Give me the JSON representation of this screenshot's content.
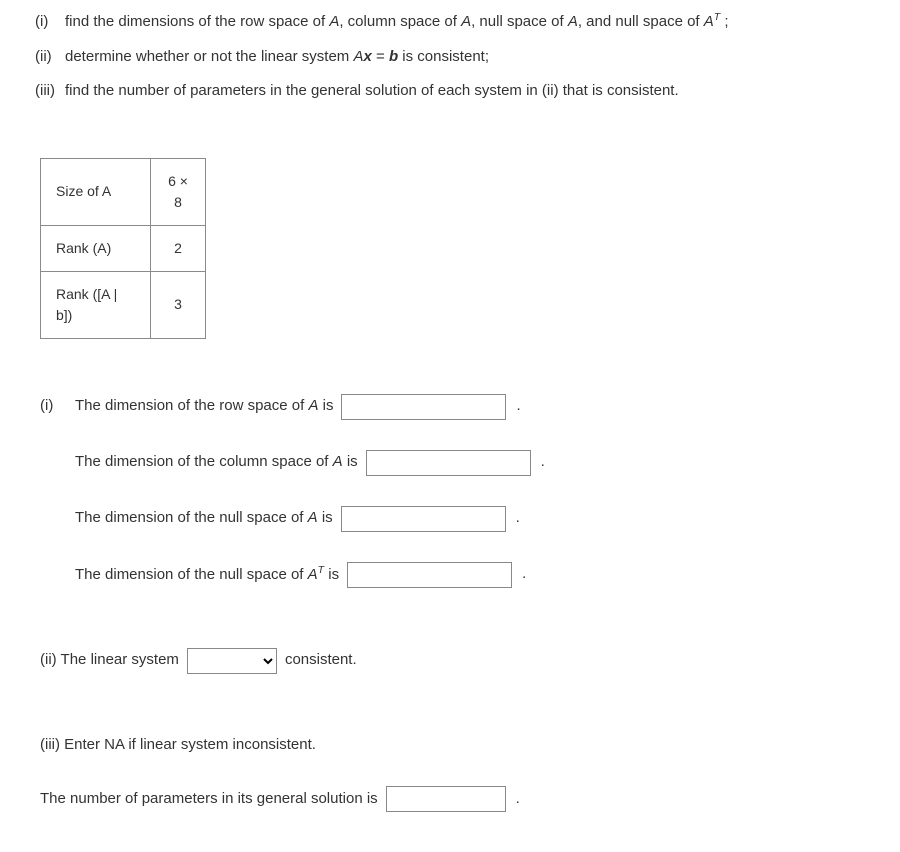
{
  "items": {
    "i_num": "(i)",
    "i_text_1": "find the dimensions of the row space of ",
    "i_text_2": ", column space of ",
    "i_text_3": ", null space of ",
    "i_text_4": ", and null space of ",
    "i_text_5": " ;",
    "ii_num": "(ii)",
    "ii_text_1": "determine whether or not the linear system ",
    "ii_text_2": " = ",
    "ii_text_3": " is consistent;",
    "iii_num": "(iii)",
    "iii_text": "find the number of parameters in the general solution of each system in (ii) that is consistent."
  },
  "A": "A",
  "AT_sup": "T",
  "x": "x",
  "b": "b",
  "table": {
    "row1_label": "Size of A",
    "row1_value": "6 × 8",
    "row2_label": "Rank (A)",
    "row2_value": "2",
    "row3_label": "Rank ([A | b])",
    "row3_value": "3"
  },
  "answers": {
    "i_prefix": "(i)",
    "row_space": "The dimension of the row space of ",
    "row_space_after": " is ",
    "col_space": "The dimension of the column space of ",
    "col_space_after": " is ",
    "null_space": "The dimension of the null space of ",
    "null_space_after": " is ",
    "null_space_t": "The dimension of the null space of ",
    "null_space_t_after": " is ",
    "ii_text_1": "(ii) The linear system ",
    "ii_text_2": " consistent.",
    "iii_text": "(iii) Enter NA if linear system inconsistent.",
    "params_text": "The number of parameters in its general solution is "
  },
  "period": "."
}
